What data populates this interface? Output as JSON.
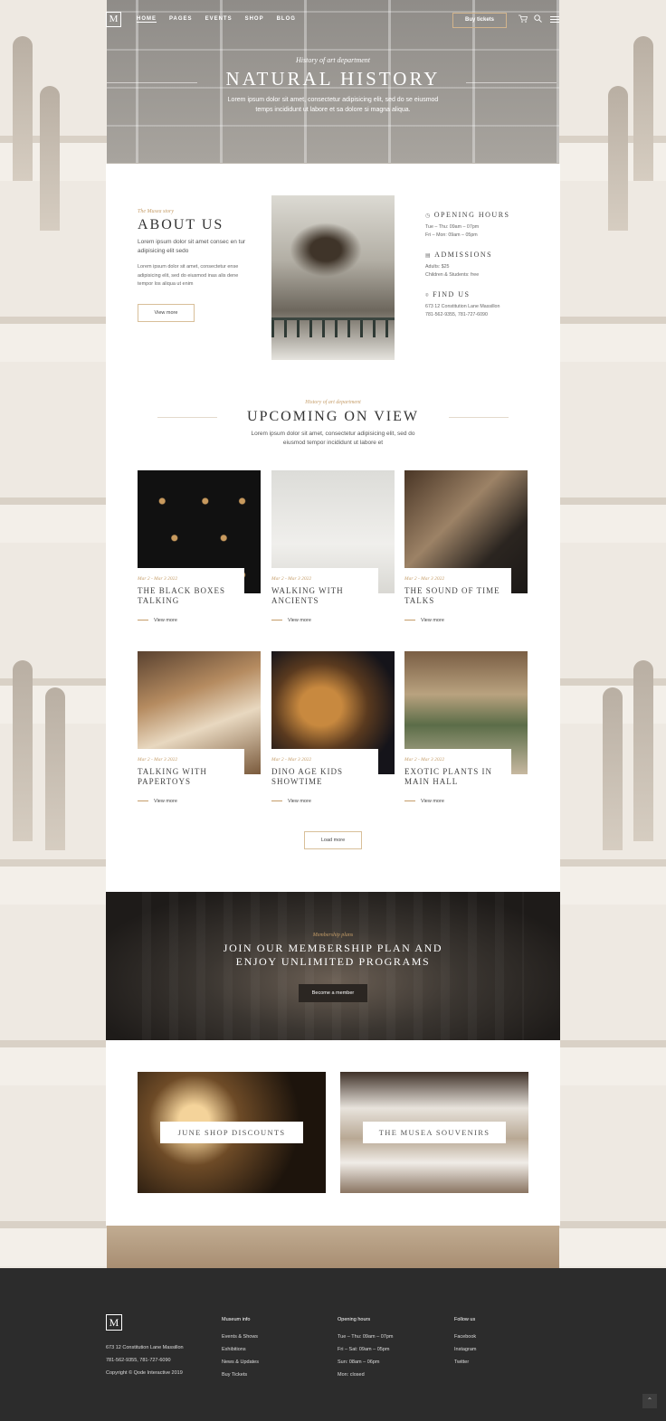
{
  "header": {
    "logo": "M",
    "nav": [
      "Home",
      "Pages",
      "Events",
      "Shop",
      "Blog"
    ],
    "tickets": "Buy tickets"
  },
  "hero": {
    "kicker": "History of art department",
    "title": "NATURAL HISTORY",
    "desc_1": "Lorem ipsum dolor sit amet, consectetur adipisicing elit, sed do se eiusmod",
    "desc_2": "temps incididunt ut labore et sa dolore si magna aliqua."
  },
  "about": {
    "kicker": "The Musea story",
    "title": "ABOUT US",
    "lead": "Lorem ipsum dolor sit amet consec en tur adipisicing elit sedo",
    "body": "Lorem ipsum dolor sit amet, consectetur ense adipisicing elit, sed do eiusmod inas alis dene tempor los aliqua ut enim",
    "button": "View more"
  },
  "info": {
    "hours_title": "OPENING HOURS",
    "hours_1": "Tue – Thu: 09am – 07pm",
    "hours_2": "Fri – Mon: 09am – 05pm",
    "adm_title": "ADMISSIONS",
    "adm_1": "Adults: $25",
    "adm_2": "Children & Students: free",
    "find_title": "FIND US",
    "find_1": "673 12 Constitution Lane Massillon",
    "find_2": "781-562-9355, 781-727-6090"
  },
  "upcoming": {
    "kicker": "History of art department",
    "title": "UPCOMING ON VIEW",
    "desc_1": "Lorem ipsum dolor sit amet, consectetur adipisicing elit, sed do",
    "desc_2": "eiusmod tempor incididunt ut labore et",
    "link": "View more",
    "load_more": "Load more",
    "items": [
      {
        "date": "Mar 2 - Mar 3 2022",
        "title": "THE BLACK BOXES TALKING"
      },
      {
        "date": "Mar 2 - Mar 3 2022",
        "title": "WALKING WITH ANCIENTS"
      },
      {
        "date": "Mar 2 - Mar 3 2022",
        "title": "THE SOUND OF TIME TALKS"
      },
      {
        "date": "Mar 2 - Mar 3 2022",
        "title": "TALKING WITH PAPERTOYS"
      },
      {
        "date": "Mar 2 - Mar 3 2022",
        "title": "DINO AGE KIDS SHOWTIME"
      },
      {
        "date": "Mar 2 - Mar 3 2022",
        "title": "EXOTIC PLANTS IN MAIN HALL"
      }
    ]
  },
  "membership": {
    "kicker": "Membership plans",
    "title_1": "JOIN OUR MEMBERSHIP PLAN AND",
    "title_2": "ENJOY UNLIMITED PROGRAMS",
    "button": "Become a member"
  },
  "promos": [
    "JUNE SHOP DISCOUNTS",
    "THE MUSEA SOUVENIRS"
  ],
  "footer": {
    "logo": "M",
    "address": "673 12 Constitution Lane Massillon",
    "phone": "781-562-9355, 781-727-6090",
    "copyright": "Copyright © Qode Interactive 2019",
    "col1": {
      "title": "Museum info",
      "links": [
        "Events & Shows",
        "Exhibitions",
        "News & Updates",
        "Buy Tickets"
      ]
    },
    "col2": {
      "title": "Opening hours",
      "links": [
        "Tue – Thu: 09am – 07pm",
        "Fri – Sat: 09am – 05pm",
        "Sun: 08am – 06pm",
        "Mon: closed"
      ]
    },
    "col3": {
      "title": "Follow us",
      "links": [
        "Facebook",
        "Instagram",
        "Twitter"
      ]
    }
  }
}
